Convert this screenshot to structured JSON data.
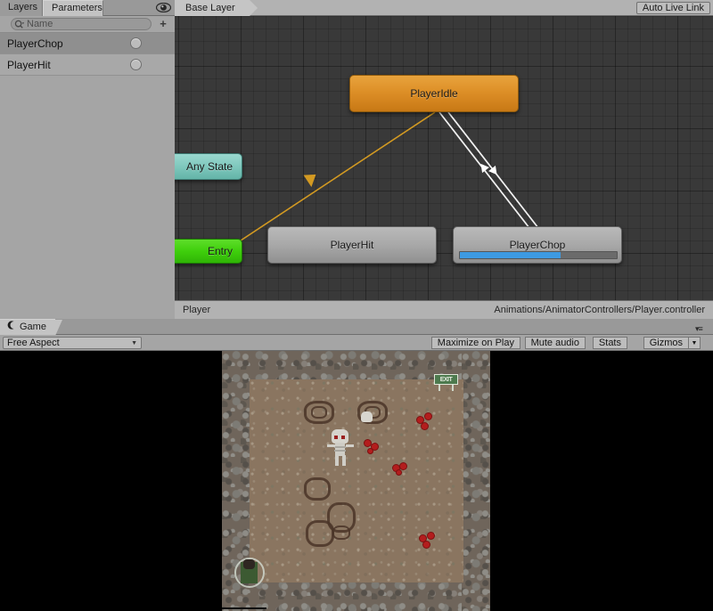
{
  "animator": {
    "param_panel": {
      "tabs": [
        {
          "label": "Layers",
          "active": false
        },
        {
          "label": "Parameters",
          "active": true
        }
      ],
      "eye_icon": "eye-icon",
      "search": {
        "placeholder": "Name",
        "value": "",
        "icon": "search-icon"
      },
      "add_button": "+",
      "parameters": [
        {
          "name": "PlayerChop",
          "type": "trigger"
        },
        {
          "name": "PlayerHit",
          "type": "trigger"
        }
      ]
    },
    "graph": {
      "breadcrumb": "Base Layer",
      "auto_live_link": "Auto Live Link",
      "nodes": [
        {
          "name": "PlayerIdle",
          "style": "orange",
          "progress": null
        },
        {
          "name": "PlayerHit",
          "style": "gray",
          "progress": null
        },
        {
          "name": "PlayerChop",
          "style": "gray",
          "progress": 64
        },
        {
          "name": "Any State",
          "style": "teal",
          "progress": null
        },
        {
          "name": "Entry",
          "style": "green",
          "progress": null
        }
      ],
      "colors": {
        "active_state": "#dd8f27",
        "normal_state": "#a9a9a9",
        "any_state": "#7fc8bd",
        "entry_state": "#3fcf0c",
        "progress_fill": "#3d9ae2",
        "transition_line": "#ffffff",
        "entry_transition_line": "#d39a22",
        "grid_background": "#393939"
      },
      "footer": {
        "object": "Player",
        "asset_path": "Animations/AnimatorControllers/Player.controller"
      }
    }
  },
  "game": {
    "tab": {
      "label": "Game",
      "icon": "game-view-icon"
    },
    "toolbar": {
      "aspect": {
        "value": "Free Aspect",
        "icon": "chevron-down-icon"
      },
      "buttons": [
        {
          "label": "Maximize on Play"
        },
        {
          "label": "Mute audio"
        },
        {
          "label": "Stats"
        },
        {
          "label": "Gizmos"
        }
      ],
      "menu_icon": "overflow-menu-icon"
    },
    "scene": {
      "exit_sign_label": "EXIT",
      "letterbox_color": "#000000",
      "floor_color": "#8a7560",
      "wall_color": "#6f655b"
    }
  }
}
